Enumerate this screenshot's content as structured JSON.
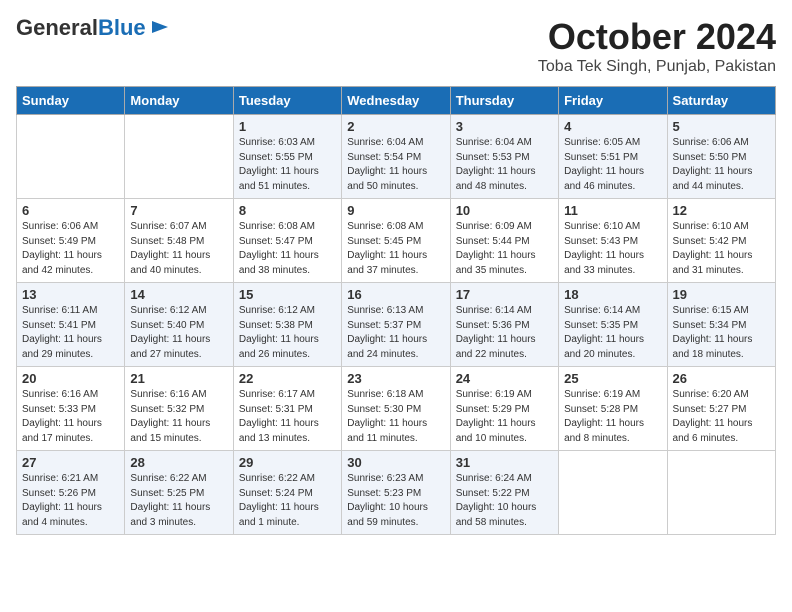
{
  "header": {
    "logo_line1": "General",
    "logo_line2": "Blue",
    "title": "October 2024",
    "subtitle": "Toba Tek Singh, Punjab, Pakistan"
  },
  "days_of_week": [
    "Sunday",
    "Monday",
    "Tuesday",
    "Wednesday",
    "Thursday",
    "Friday",
    "Saturday"
  ],
  "weeks": [
    [
      {
        "day": "",
        "info": ""
      },
      {
        "day": "",
        "info": ""
      },
      {
        "day": "1",
        "info": "Sunrise: 6:03 AM\nSunset: 5:55 PM\nDaylight: 11 hours and 51 minutes."
      },
      {
        "day": "2",
        "info": "Sunrise: 6:04 AM\nSunset: 5:54 PM\nDaylight: 11 hours and 50 minutes."
      },
      {
        "day": "3",
        "info": "Sunrise: 6:04 AM\nSunset: 5:53 PM\nDaylight: 11 hours and 48 minutes."
      },
      {
        "day": "4",
        "info": "Sunrise: 6:05 AM\nSunset: 5:51 PM\nDaylight: 11 hours and 46 minutes."
      },
      {
        "day": "5",
        "info": "Sunrise: 6:06 AM\nSunset: 5:50 PM\nDaylight: 11 hours and 44 minutes."
      }
    ],
    [
      {
        "day": "6",
        "info": "Sunrise: 6:06 AM\nSunset: 5:49 PM\nDaylight: 11 hours and 42 minutes."
      },
      {
        "day": "7",
        "info": "Sunrise: 6:07 AM\nSunset: 5:48 PM\nDaylight: 11 hours and 40 minutes."
      },
      {
        "day": "8",
        "info": "Sunrise: 6:08 AM\nSunset: 5:47 PM\nDaylight: 11 hours and 38 minutes."
      },
      {
        "day": "9",
        "info": "Sunrise: 6:08 AM\nSunset: 5:45 PM\nDaylight: 11 hours and 37 minutes."
      },
      {
        "day": "10",
        "info": "Sunrise: 6:09 AM\nSunset: 5:44 PM\nDaylight: 11 hours and 35 minutes."
      },
      {
        "day": "11",
        "info": "Sunrise: 6:10 AM\nSunset: 5:43 PM\nDaylight: 11 hours and 33 minutes."
      },
      {
        "day": "12",
        "info": "Sunrise: 6:10 AM\nSunset: 5:42 PM\nDaylight: 11 hours and 31 minutes."
      }
    ],
    [
      {
        "day": "13",
        "info": "Sunrise: 6:11 AM\nSunset: 5:41 PM\nDaylight: 11 hours and 29 minutes."
      },
      {
        "day": "14",
        "info": "Sunrise: 6:12 AM\nSunset: 5:40 PM\nDaylight: 11 hours and 27 minutes."
      },
      {
        "day": "15",
        "info": "Sunrise: 6:12 AM\nSunset: 5:38 PM\nDaylight: 11 hours and 26 minutes."
      },
      {
        "day": "16",
        "info": "Sunrise: 6:13 AM\nSunset: 5:37 PM\nDaylight: 11 hours and 24 minutes."
      },
      {
        "day": "17",
        "info": "Sunrise: 6:14 AM\nSunset: 5:36 PM\nDaylight: 11 hours and 22 minutes."
      },
      {
        "day": "18",
        "info": "Sunrise: 6:14 AM\nSunset: 5:35 PM\nDaylight: 11 hours and 20 minutes."
      },
      {
        "day": "19",
        "info": "Sunrise: 6:15 AM\nSunset: 5:34 PM\nDaylight: 11 hours and 18 minutes."
      }
    ],
    [
      {
        "day": "20",
        "info": "Sunrise: 6:16 AM\nSunset: 5:33 PM\nDaylight: 11 hours and 17 minutes."
      },
      {
        "day": "21",
        "info": "Sunrise: 6:16 AM\nSunset: 5:32 PM\nDaylight: 11 hours and 15 minutes."
      },
      {
        "day": "22",
        "info": "Sunrise: 6:17 AM\nSunset: 5:31 PM\nDaylight: 11 hours and 13 minutes."
      },
      {
        "day": "23",
        "info": "Sunrise: 6:18 AM\nSunset: 5:30 PM\nDaylight: 11 hours and 11 minutes."
      },
      {
        "day": "24",
        "info": "Sunrise: 6:19 AM\nSunset: 5:29 PM\nDaylight: 11 hours and 10 minutes."
      },
      {
        "day": "25",
        "info": "Sunrise: 6:19 AM\nSunset: 5:28 PM\nDaylight: 11 hours and 8 minutes."
      },
      {
        "day": "26",
        "info": "Sunrise: 6:20 AM\nSunset: 5:27 PM\nDaylight: 11 hours and 6 minutes."
      }
    ],
    [
      {
        "day": "27",
        "info": "Sunrise: 6:21 AM\nSunset: 5:26 PM\nDaylight: 11 hours and 4 minutes."
      },
      {
        "day": "28",
        "info": "Sunrise: 6:22 AM\nSunset: 5:25 PM\nDaylight: 11 hours and 3 minutes."
      },
      {
        "day": "29",
        "info": "Sunrise: 6:22 AM\nSunset: 5:24 PM\nDaylight: 11 hours and 1 minute."
      },
      {
        "day": "30",
        "info": "Sunrise: 6:23 AM\nSunset: 5:23 PM\nDaylight: 10 hours and 59 minutes."
      },
      {
        "day": "31",
        "info": "Sunrise: 6:24 AM\nSunset: 5:22 PM\nDaylight: 10 hours and 58 minutes."
      },
      {
        "day": "",
        "info": ""
      },
      {
        "day": "",
        "info": ""
      }
    ]
  ]
}
